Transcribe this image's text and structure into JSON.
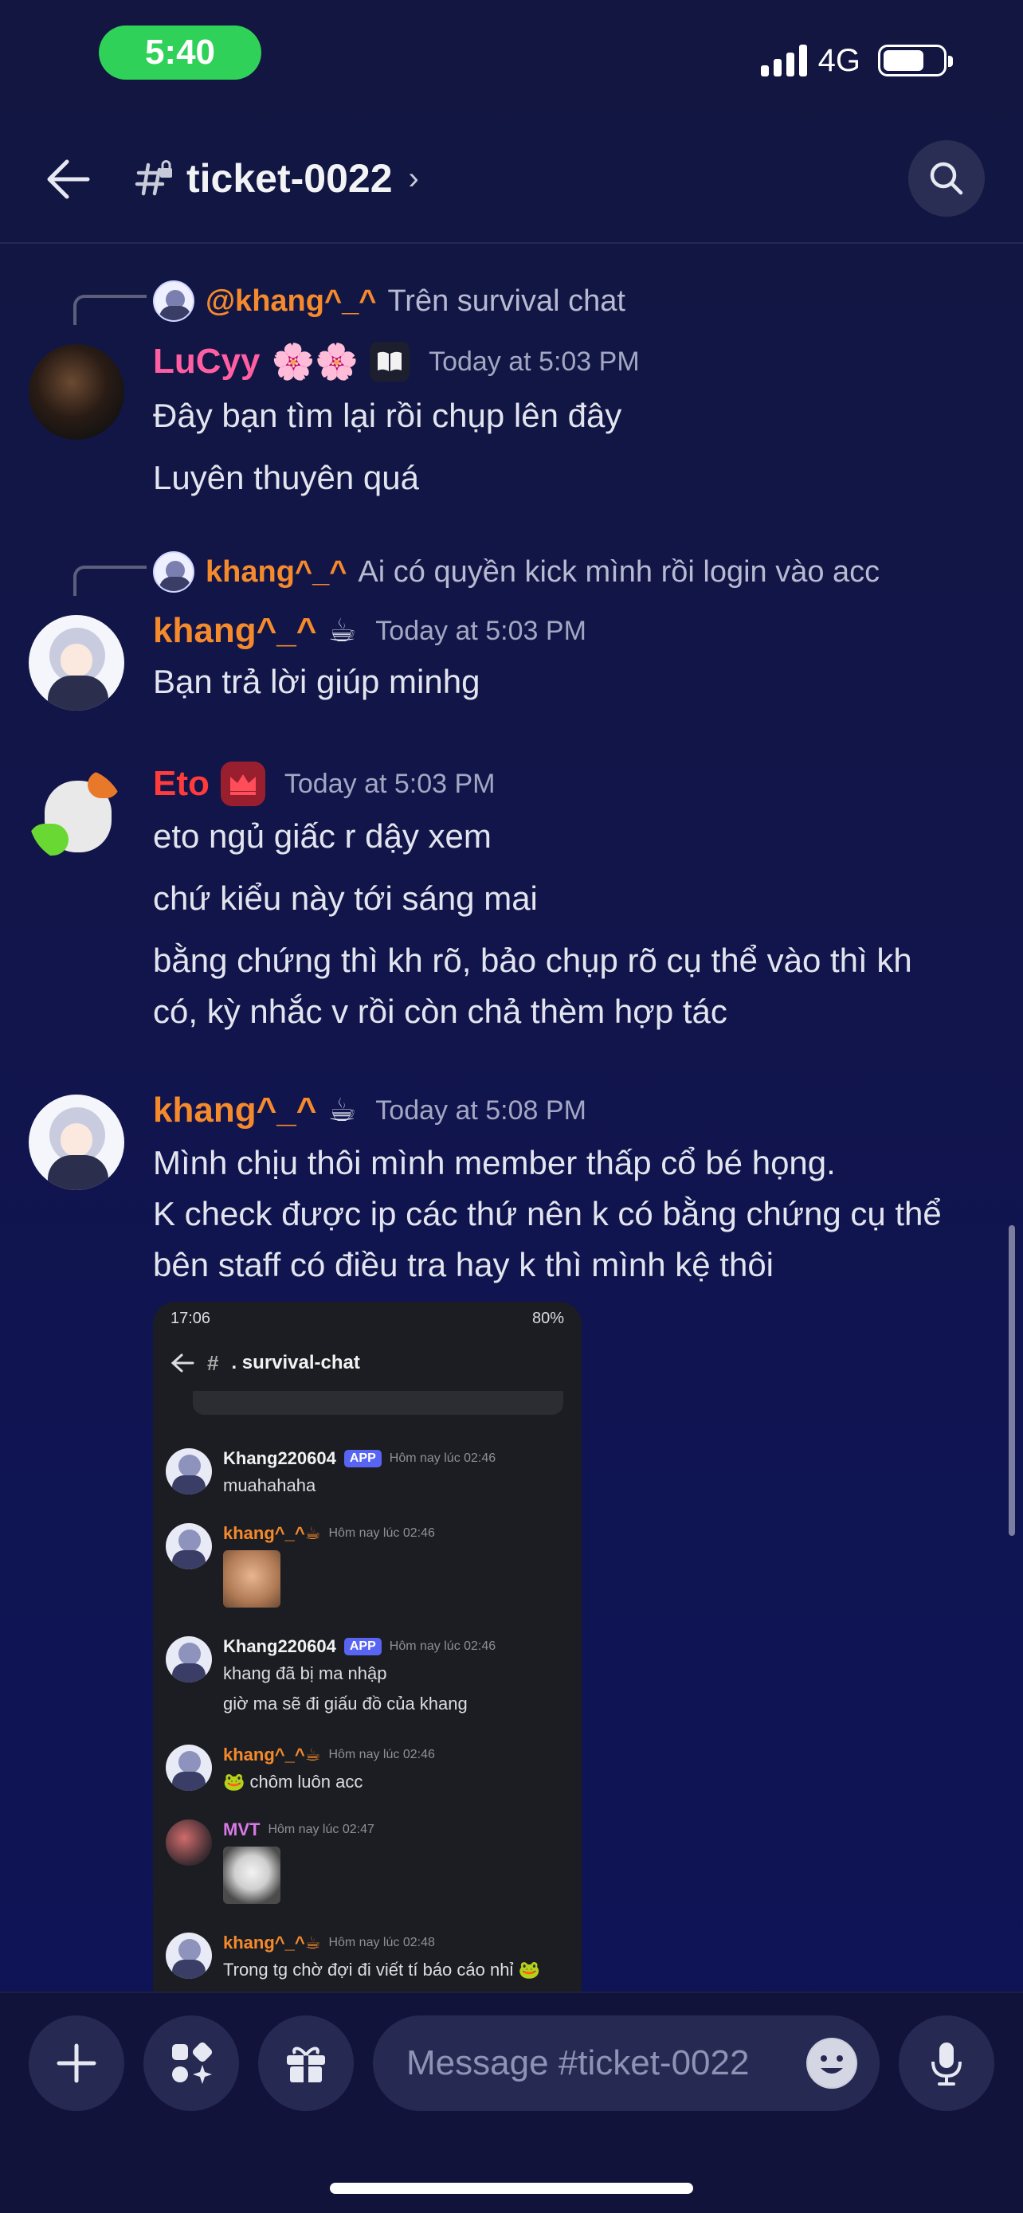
{
  "status_bar": {
    "time": "5:40",
    "network": "4G"
  },
  "header": {
    "channel": "ticket-0022",
    "chevron": "›"
  },
  "messages": [
    {
      "reply_to": {
        "user": "@khang^_^",
        "text": "Trên survival chat"
      },
      "user": "LuCyy",
      "user_emoji": "🌸🌸",
      "badge": "book-icon",
      "timestamp": "Today at 5:03 PM",
      "lines": [
        "Đây bạn tìm lại rồi chụp lên đây",
        "Luyên thuyên quá"
      ]
    },
    {
      "reply_to": {
        "user": "khang^_^",
        "text": "Ai có quyền kick mình rồi login vào acc"
      },
      "user": "khang^_^",
      "user_emoji": "☕",
      "timestamp": "Today at 5:03 PM",
      "lines": [
        "Bạn trả lời giúp minhg"
      ]
    },
    {
      "user": "Eto",
      "badge": "crown-icon",
      "timestamp": "Today at 5:03 PM",
      "lines": [
        "eto ngủ giấc r dậy xem",
        "chứ kiểu này tới sáng mai",
        "bằng chứng thì kh rõ, bảo chụp rõ cụ thể vào thì kh",
        "có, kỳ nhắc v rồi còn chả thèm hợp tác"
      ]
    },
    {
      "user": "khang^_^",
      "user_emoji": "☕",
      "timestamp": "Today at 5:08 PM",
      "lines": [
        "Mình chịu thôi mình member thấp cổ bé họng.",
        "K check được ip các thứ nên k có bằng chứng cụ thể",
        "bên staff có điều tra hay k thì mình kệ thôi"
      ]
    }
  ],
  "screenshot": {
    "time": "17:06",
    "battery": "80%",
    "channel": ". survival-chat",
    "entries": [
      {
        "user": "Khang220604",
        "tag": "APP",
        "ts": "Hôm nay lúc 02:46",
        "lines": [
          "muahahaha"
        ]
      },
      {
        "user": "khang^_^☕",
        "ts": "Hôm nay lúc 02:46",
        "image": "cat-photo"
      },
      {
        "user": "Khang220604",
        "tag": "APP",
        "ts": "Hôm nay lúc 02:46",
        "lines": [
          "khang đã bị ma nhập",
          "giờ ma sẽ đi giấu đồ của khang"
        ]
      },
      {
        "user": "khang^_^☕",
        "ts": "Hôm nay lúc 02:46",
        "lines": [
          "🐸 chôm luôn acc"
        ]
      },
      {
        "user": "MVT",
        "ts": "Hôm nay lúc 02:47",
        "image": "dog-photo"
      },
      {
        "user": "khang^_^☕",
        "ts": "Hôm nay lúc 02:48",
        "lines": [
          "Trong tg chờ đợi đi viết tí báo cáo nhỉ 🐸"
        ]
      }
    ]
  },
  "composer": {
    "placeholder": "Message #ticket-0022"
  },
  "colors": {
    "background": "#12154a",
    "accent_green": "#2fd158",
    "khang_orange": "#f58a2c",
    "lucy_pink": "#ff5fa2",
    "eto_red": "#ff3b3b"
  }
}
